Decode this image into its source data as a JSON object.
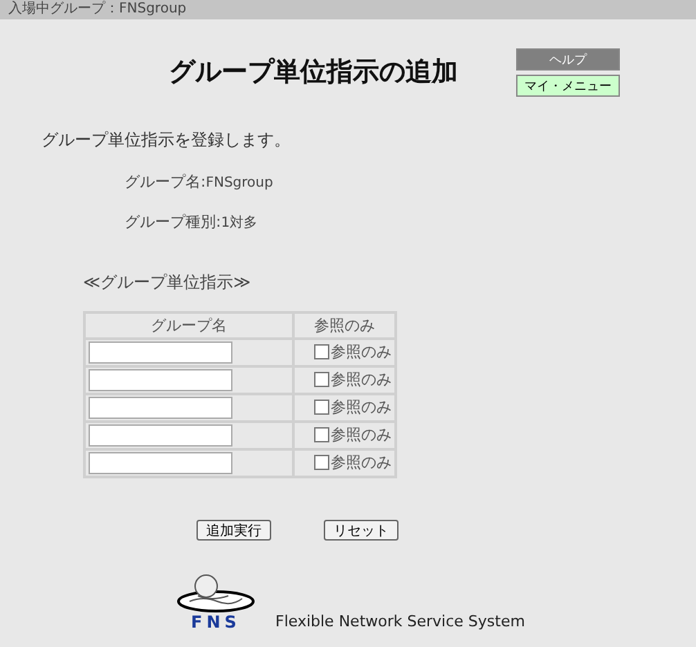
{
  "status_bar": {
    "text": "入場中グループ：FNSgroup"
  },
  "title": "グループ単位指示の追加",
  "side_buttons": [
    {
      "label": "ヘルプ",
      "kind": "help"
    },
    {
      "label": "マイ・メニュー",
      "kind": "menu"
    }
  ],
  "description": "グループ単位指示を登録します。",
  "info": [
    {
      "label": "グループ名:",
      "value": "FNSgroup"
    },
    {
      "label": "グループ種別:",
      "value": "1対多"
    }
  ],
  "section_title": "≪グループ単位指示≫",
  "table": {
    "columns": [
      "グループ名",
      "参照のみ"
    ],
    "rows": [
      {
        "checkbox_label": "参照のみ",
        "checked": false
      },
      {
        "checkbox_label": "参照のみ",
        "checked": false
      },
      {
        "checkbox_label": "参照のみ",
        "checked": false
      },
      {
        "checkbox_label": "参照のみ",
        "checked": false
      },
      {
        "checkbox_label": "参照のみ",
        "checked": false
      }
    ]
  },
  "buttons": [
    "追加実行",
    "リセット"
  ],
  "footer": {
    "logo_text": "FNS",
    "tagline": "Flexible Network Service System"
  }
}
